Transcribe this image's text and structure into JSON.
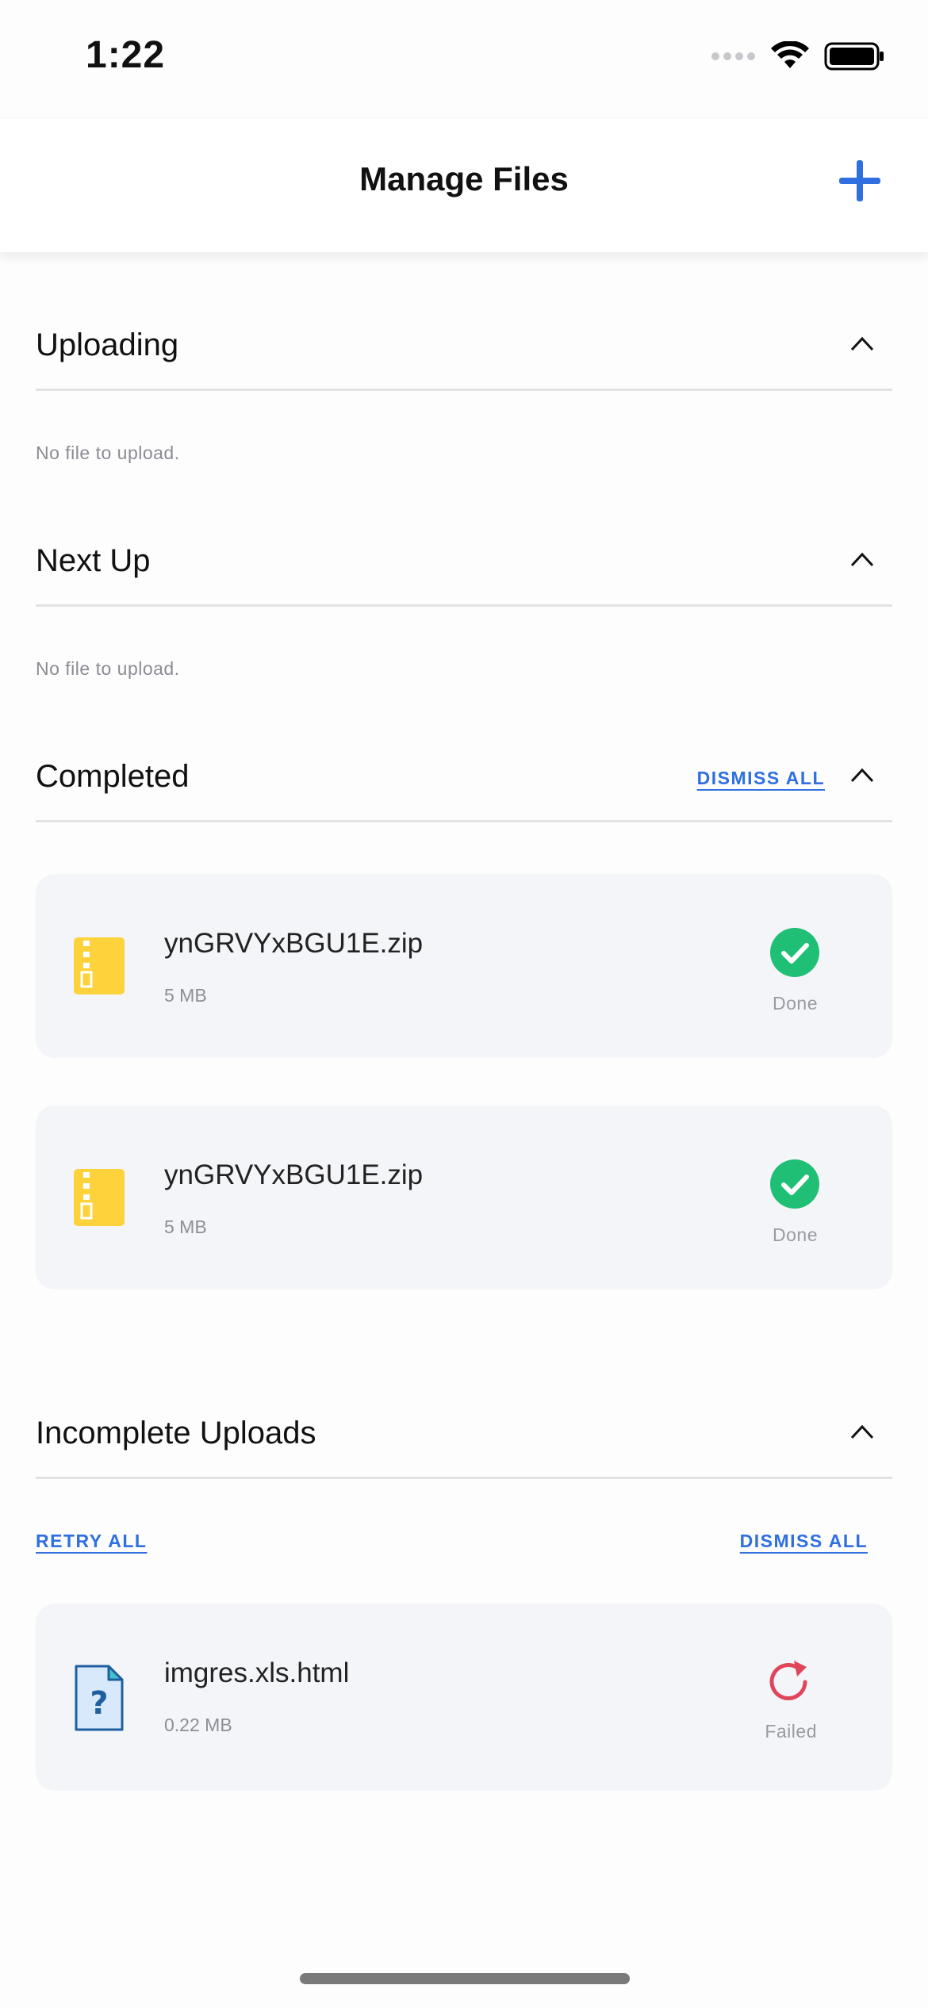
{
  "status_bar": {
    "time": "1:22"
  },
  "nav": {
    "title": "Manage Files",
    "add_icon": "plus-icon",
    "accent": "#2f6fe0"
  },
  "sections": {
    "uploading": {
      "title": "Uploading",
      "empty_text": "No file to upload."
    },
    "next_up": {
      "title": "Next Up",
      "empty_text": "No file to upload."
    },
    "completed": {
      "title": "Completed",
      "dismiss_all": "DISMISS ALL",
      "files": [
        {
          "name": "ynGRVYxBGU1E.zip",
          "size": "5 MB",
          "status": "Done",
          "icon": "zip-file-icon"
        },
        {
          "name": "ynGRVYxBGU1E.zip",
          "size": "5 MB",
          "status": "Done",
          "icon": "zip-file-icon"
        }
      ]
    },
    "incomplete": {
      "title": "Incomplete Uploads",
      "retry_all": "RETRY ALL",
      "dismiss_all": "DISMISS ALL",
      "files": [
        {
          "name": "imgres.xls.html",
          "size": "0.22 MB",
          "status": "Failed",
          "icon": "unknown-file-icon"
        }
      ]
    }
  },
  "colors": {
    "success": "#1fbf75",
    "failed": "#e0455a",
    "zip": "#fdd23a",
    "link": "#2f6fe0"
  }
}
